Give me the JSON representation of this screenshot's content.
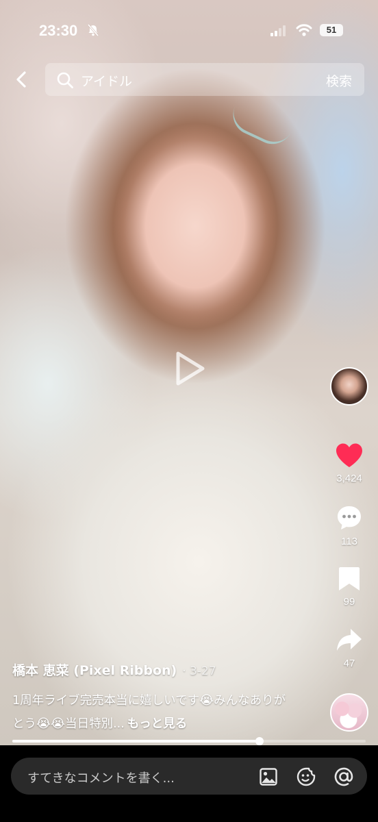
{
  "status_bar": {
    "time": "23:30",
    "battery": "51"
  },
  "search": {
    "query": "アイドル",
    "button_label": "検索"
  },
  "post": {
    "author": "橋本 恵菜 (Pixel Ribbon)",
    "date": "3-27",
    "caption_parts": {
      "part1": "1周年ライブ完売本当に嬉しいです",
      "emoji1": "😭",
      "part2": "みんなありがとう",
      "emoji2": "😭",
      "emoji3": "😭",
      "part3": "当日特別...",
      "more": "もっと見る"
    }
  },
  "actions": {
    "likes": "3,424",
    "comments": "113",
    "saves": "99",
    "shares": "47"
  },
  "progress": {
    "fraction": 0.7
  },
  "comment_bar": {
    "placeholder": "すてきなコメントを書く..."
  },
  "colors": {
    "like_active": "#fe2c55",
    "comment_bar_bg": "#2a2a2a"
  },
  "icons": [
    "bell-mute-icon",
    "signal-icon",
    "wifi-icon",
    "back-icon",
    "search-icon",
    "play-icon",
    "heart-icon",
    "comment-icon",
    "bookmark-icon",
    "share-icon",
    "image-icon",
    "emoji-icon",
    "mention-icon"
  ]
}
